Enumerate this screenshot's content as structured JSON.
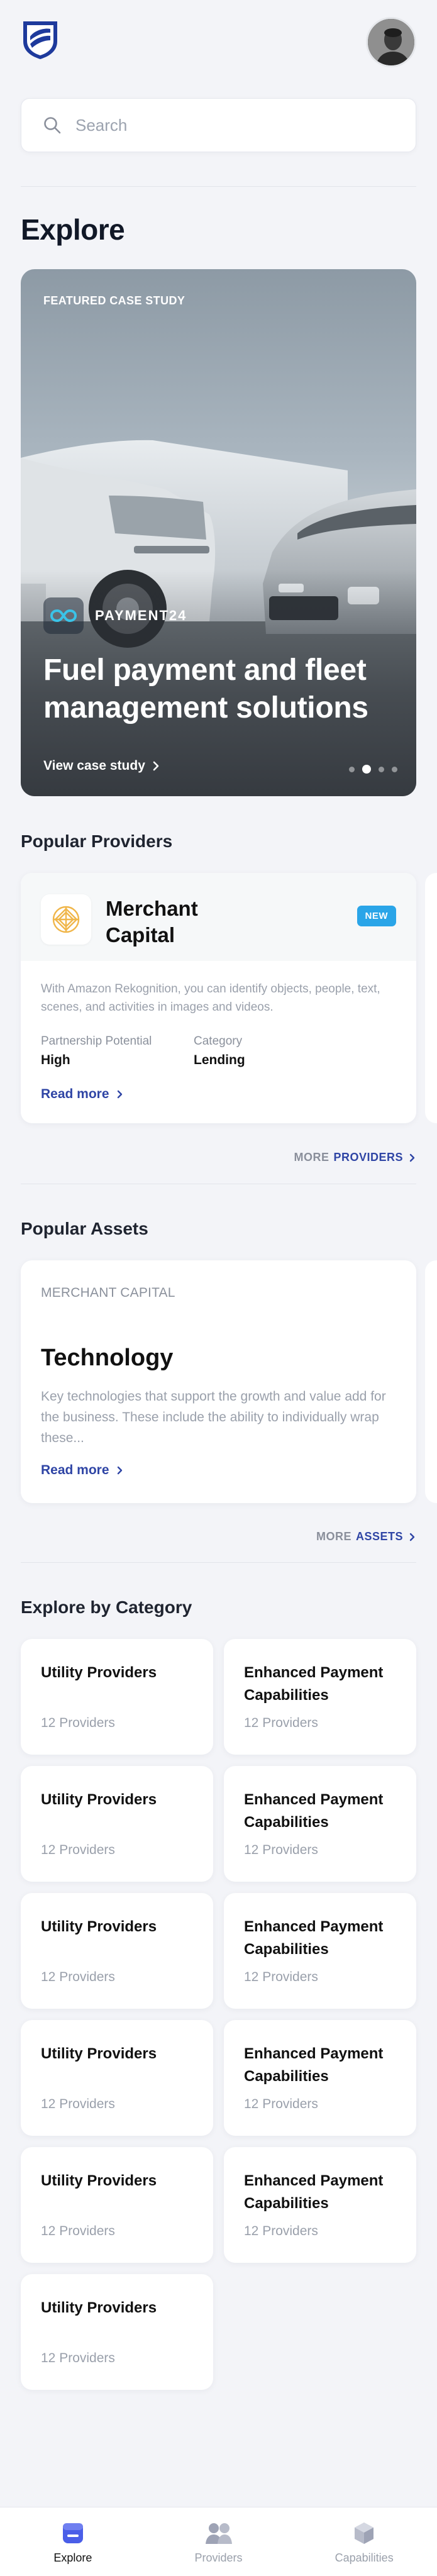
{
  "header": {
    "logo": "bank-shield-logo",
    "avatar": "user-avatar"
  },
  "search": {
    "placeholder": "Search"
  },
  "page": {
    "title": "Explore"
  },
  "featured": {
    "eyebrow": "FEATURED CASE STUDY",
    "brand": "PAYMENT24",
    "headline": "Fuel payment and fleet management solutions",
    "cta": "View case study",
    "slide_count": 4,
    "active_slide": 2
  },
  "providers": {
    "section_title": "Popular Providers",
    "card": {
      "name": "Merchant Capital",
      "badge": "NEW",
      "description": "With Amazon Rekognition, you can identify objects, people, text, scenes, and activities in images and videos.",
      "meta1_label": "Partnership Potential",
      "meta1_value": "High",
      "meta2_label": "Category",
      "meta2_value": "Lending",
      "read_more": "Read more"
    },
    "more_prefix": "MORE",
    "more_accent": "PROVIDERS"
  },
  "assets": {
    "section_title": "Popular Assets",
    "card": {
      "eyebrow": "MERCHANT CAPITAL",
      "title": "Technology",
      "description": "Key technologies that support the growth and value add for the business. These include the ability to individually wrap these...",
      "read_more": "Read more"
    },
    "more_prefix": "MORE",
    "more_accent": "ASSETS"
  },
  "categories": {
    "section_title": "Explore by Category",
    "items": [
      {
        "title": "Utility Providers",
        "count": "12 Providers"
      },
      {
        "title": "Enhanced Payment Capabilities",
        "count": "12 Providers"
      },
      {
        "title": "Utility Providers",
        "count": "12 Providers"
      },
      {
        "title": "Enhanced Payment Capabilities",
        "count": "12 Providers"
      },
      {
        "title": "Utility Providers",
        "count": "12 Providers"
      },
      {
        "title": "Enhanced Payment Capabilities",
        "count": "12 Providers"
      },
      {
        "title": "Utility Providers",
        "count": "12 Providers"
      },
      {
        "title": "Enhanced Payment Capabilities",
        "count": "12 Providers"
      },
      {
        "title": "Utility Providers",
        "count": "12 Providers"
      },
      {
        "title": "Enhanced Payment Capabilities",
        "count": "12 Providers"
      },
      {
        "title": "Utility Providers",
        "count": "12 Providers"
      }
    ]
  },
  "nav": {
    "items": [
      {
        "label": "Explore",
        "icon": "explore-icon",
        "active": true
      },
      {
        "label": "Providers",
        "icon": "providers-icon",
        "active": false
      },
      {
        "label": "Capabilities",
        "icon": "capabilities-icon",
        "active": false
      }
    ]
  },
  "colors": {
    "accent": "#2f45a5",
    "badge": "#2aa5e8",
    "nav_active": "#4a5ee8",
    "background": "#f3f4f8"
  }
}
